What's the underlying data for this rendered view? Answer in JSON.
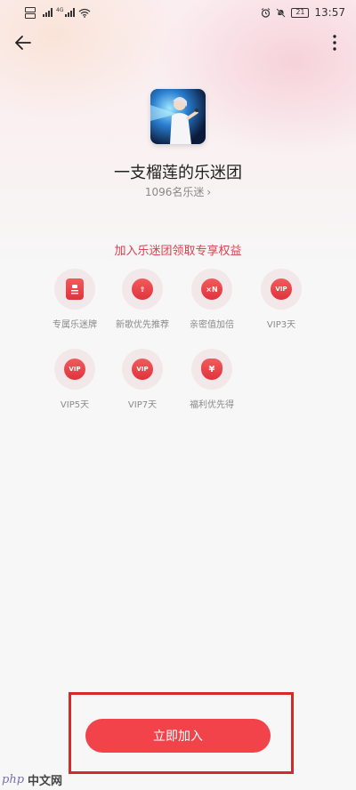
{
  "status_bar": {
    "net_label": "4G",
    "battery": "21",
    "time": "13:57"
  },
  "nav": {
    "back_icon": "arrow-left-icon",
    "more_icon": "more-vertical-icon"
  },
  "header": {
    "group_name": "一支榴莲的乐迷团",
    "fan_count": "1096名乐迷",
    "fan_count_chevron": "›"
  },
  "benefits": {
    "title": "加入乐迷团领取专享权益",
    "items": [
      {
        "label": "专属乐迷牌",
        "icon": "badge-card-icon",
        "glyph": ""
      },
      {
        "label": "新歌优先推荐",
        "icon": "arrow-up-icon",
        "glyph": "⇧"
      },
      {
        "label": "亲密值加倍",
        "icon": "multiply-n-icon",
        "glyph": "×N"
      },
      {
        "label": "VIP3天",
        "icon": "vip-icon",
        "glyph": "VIP"
      },
      {
        "label": "VIP5天",
        "icon": "vip-icon",
        "glyph": "VIP"
      },
      {
        "label": "VIP7天",
        "icon": "vip-icon",
        "glyph": "VIP"
      },
      {
        "label": "福利优先得",
        "icon": "money-bag-icon",
        "glyph": "¥"
      }
    ]
  },
  "join_button": {
    "label": "立即加入"
  },
  "watermark": {
    "php": "php",
    "cn": "中文网"
  },
  "colors": {
    "accent": "#f2434a",
    "benefit_title": "#d9424f",
    "highlight_box": "#d42a2a"
  }
}
